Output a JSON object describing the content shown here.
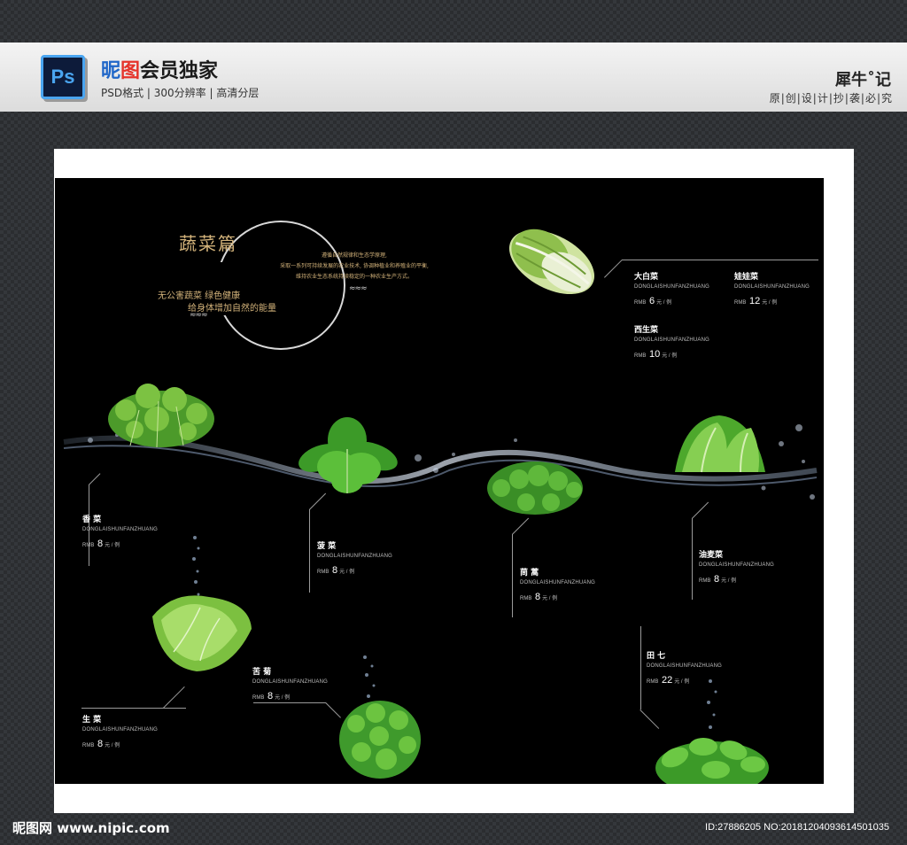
{
  "banner": {
    "ps_icon": "Ps",
    "title_blue": "昵",
    "title_red": "图",
    "title_rest": "会员独家",
    "subtitle": "PSD格式 | 300分辨率 | 高清分层",
    "author": "犀牛˚记",
    "author_sub": "原|创|设|计|抄|袭|必|究"
  },
  "poster": {
    "title": "蔬菜篇",
    "slogan_line1": "无公害蔬菜   绿色健康",
    "slogan_line2": "给身体增加自然的能量",
    "intro_line1": "遵循自然规律和生态学原理,",
    "intro_line2": "采取一系列可持续发展的农业技术, 协调种植业和养殖业的平衡,",
    "intro_line3": "维持农业生态系统持续稳定的一种农业生产方式。",
    "wave": "≈≈≈"
  },
  "products": [
    {
      "name": "大白菜",
      "en": "DONGLAISHUNFANZHUANG",
      "rmb": "RMB",
      "price": "6",
      "unit": "元 / 例"
    },
    {
      "name": "娃娃菜",
      "en": "DONGLAISHUNFANZHUANG",
      "rmb": "RMB",
      "price": "12",
      "unit": "元 / 例"
    },
    {
      "name": "西生菜",
      "en": "DONGLAISHUNFANZHUANG",
      "rmb": "RMB",
      "price": "10",
      "unit": "元 / 例"
    },
    {
      "name": "香 菜",
      "en": "DONGLAISHUNFANZHUANG",
      "rmb": "RMB",
      "price": "8",
      "unit": "元 / 例"
    },
    {
      "name": "菠 菜",
      "en": "DONGLAISHUNFANZHUANG",
      "rmb": "RMB",
      "price": "8",
      "unit": "元 / 例"
    },
    {
      "name": "茼 蒿",
      "en": "DONGLAISHUNFANZHUANG",
      "rmb": "RMB",
      "price": "8",
      "unit": "元 / 例"
    },
    {
      "name": "油麦菜",
      "en": "DONGLAISHUNFANZHUANG",
      "rmb": "RMB",
      "price": "8",
      "unit": "元 / 例"
    },
    {
      "name": "苦 菊",
      "en": "DONGLAISHUNFANZHUANG",
      "rmb": "RMB",
      "price": "8",
      "unit": "元 / 例"
    },
    {
      "name": "田 七",
      "en": "DONGLAISHUNFANZHUANG",
      "rmb": "RMB",
      "price": "22",
      "unit": "元 / 例"
    },
    {
      "name": "生 菜",
      "en": "DONGLAISHUNFANZHUANG",
      "rmb": "RMB",
      "price": "8",
      "unit": "元 / 例"
    }
  ],
  "footer": {
    "logo": "昵图网 www.nipic.com",
    "id": "ID:27886205 NO:20181204093614501035"
  }
}
